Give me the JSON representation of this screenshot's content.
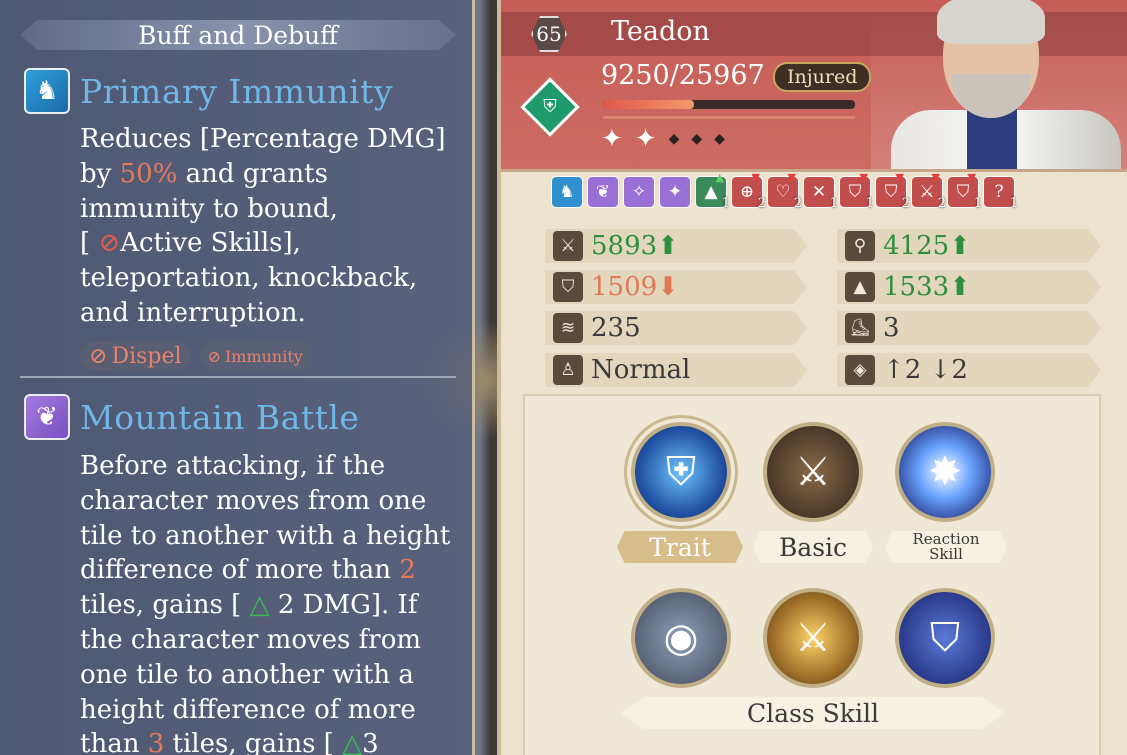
{
  "left_panel": {
    "header": "Buff and Debuff",
    "effects": [
      {
        "name": "Primary Immunity",
        "icon": "wing-horse-icon",
        "desc_lines": [
          "Reduces [Percentage DMG]",
          "by",
          "50%",
          "and grants",
          "immunity to bound,",
          "[",
          "Active Skills],",
          "teleportation, knockback,",
          "and interruption."
        ],
        "tags": [
          "Dispel",
          "Immunity"
        ]
      },
      {
        "name": "Mountain Battle",
        "icon": "feather-leaf-icon",
        "desc_lines": [
          "Before attacking, if the",
          "character moves from one",
          "tile to another with a height",
          "difference of more than",
          "2",
          "tiles, gains [",
          "2 DMG]. If",
          "the character moves from",
          "one tile to another with a",
          "height difference of more",
          "than",
          "3",
          "tiles, gains [",
          "3"
        ]
      }
    ]
  },
  "hero": {
    "level": "65",
    "name": "Teadon",
    "hp": "9250/25967",
    "hp_fraction": 0.36,
    "status": "Injured",
    "stars_filled": 2,
    "stars_total": 5
  },
  "buff_icons": [
    {
      "icon": "wing-horse-icon",
      "color": "blue"
    },
    {
      "icon": "leaf-icon",
      "color": "purple"
    },
    {
      "icon": "sparkle-icon",
      "color": "purple"
    },
    {
      "icon": "sparkle-double-icon",
      "color": "purple"
    },
    {
      "icon": "hat-up-icon",
      "color": "green",
      "count": "1"
    },
    {
      "icon": "target-down-icon",
      "color": "red",
      "count": "2"
    },
    {
      "icon": "heart-down-icon",
      "color": "red",
      "count": "2"
    },
    {
      "icon": "cross-icon",
      "color": "red",
      "count": "1"
    },
    {
      "icon": "shield-down-icon",
      "color": "red",
      "count": "1"
    },
    {
      "icon": "shield-down-icon",
      "color": "red",
      "count": "2"
    },
    {
      "icon": "sword-down-icon",
      "color": "red",
      "count": "2"
    },
    {
      "icon": "shield-down-icon",
      "color": "red",
      "count": "1"
    },
    {
      "icon": "question-icon",
      "color": "red",
      "count": "1"
    }
  ],
  "stats": {
    "atk": {
      "value": "5893",
      "trend": "up"
    },
    "mag": {
      "value": "4125",
      "trend": "up"
    },
    "def": {
      "value": "1509",
      "trend": "down"
    },
    "mdef": {
      "value": "1533",
      "trend": "up"
    },
    "tech": {
      "value": "235",
      "trend": "none"
    },
    "move": {
      "value": "3",
      "trend": "none"
    },
    "terrain": {
      "value": "Normal",
      "trend": "none"
    },
    "height_up": "2",
    "height_down": "2"
  },
  "skills": {
    "trait_label": "Trait",
    "basic_label": "Basic",
    "reaction_label_1": "Reaction",
    "reaction_label_2": "Skill",
    "class_label": "Class Skill"
  },
  "colors": {
    "hero_bg": "#c65d57",
    "accent_text": "#6fb7e6",
    "highlight_number": "#e87a5a",
    "stat_up": "#2e8f3e",
    "stat_down": "#e27858"
  }
}
